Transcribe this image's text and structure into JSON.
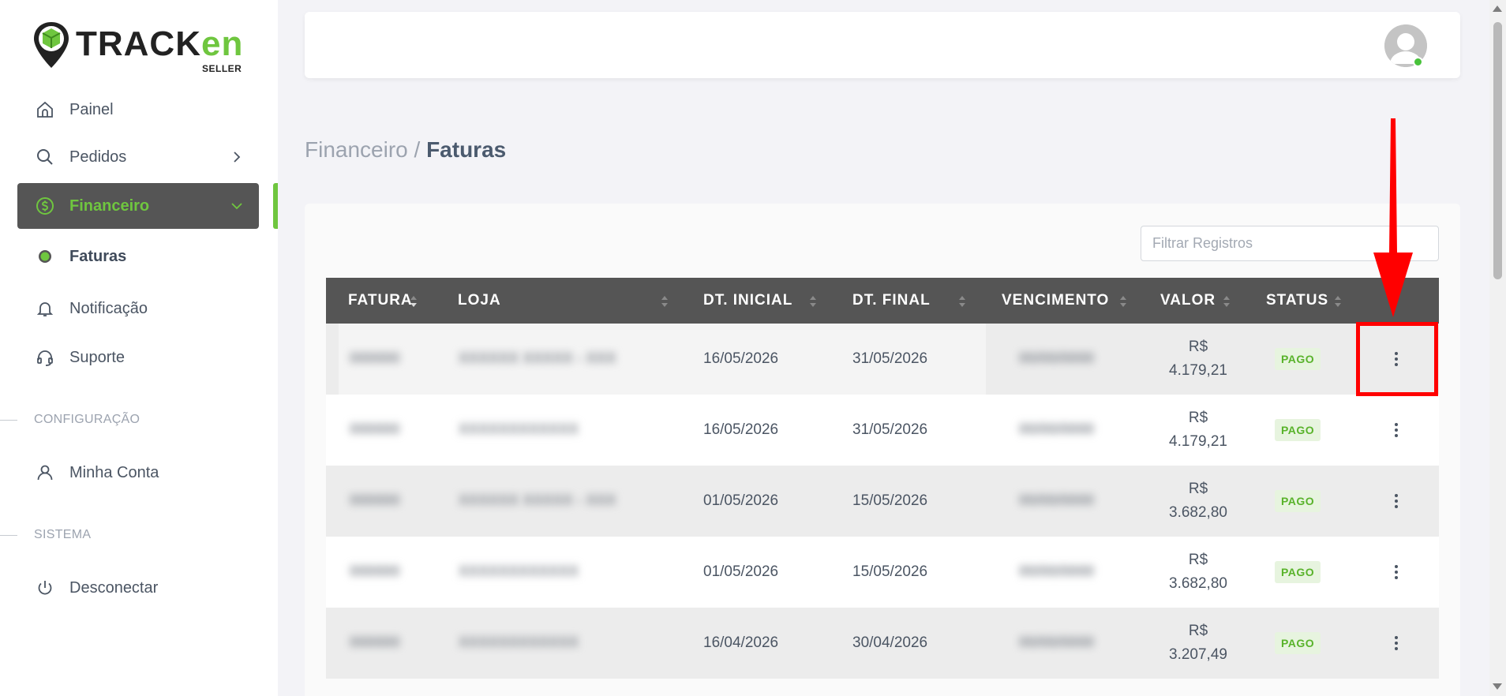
{
  "brand": {
    "name_main": "TRACK",
    "name_accent": "en",
    "sub": "SELLER",
    "accent_color": "#6fc63f"
  },
  "sidebar": {
    "items": [
      {
        "label": "Painel",
        "icon": "home-icon"
      },
      {
        "label": "Pedidos",
        "icon": "search-icon",
        "has_chevron": true
      },
      {
        "label": "Financeiro",
        "icon": "dollar-circle-icon",
        "active": true,
        "expanded": true
      },
      {
        "label": "Faturas",
        "icon": "dot-icon",
        "sub": true
      },
      {
        "label": "Notificação",
        "icon": "bell-icon"
      },
      {
        "label": "Suporte",
        "icon": "headset-icon"
      },
      {
        "label": "Minha Conta",
        "icon": "user-icon"
      },
      {
        "label": "Desconectar",
        "icon": "power-icon"
      }
    ],
    "sections": [
      "CONFIGURAÇÃO",
      "SISTEMA"
    ]
  },
  "breadcrumb": {
    "parent": "Financeiro",
    "separator": "/",
    "current": "Faturas"
  },
  "filter": {
    "placeholder": "Filtrar Registros",
    "value": ""
  },
  "table": {
    "columns": [
      "FATURA",
      "LOJA",
      "DT. INICIAL",
      "DT. FINAL",
      "VENCIMENTO",
      "VALOR",
      "STATUS"
    ],
    "rows": [
      {
        "fatura": "000000",
        "loja": "XXXXXX XXXXX - XXX",
        "dt_inicial": "16/05/2026",
        "dt_final": "31/05/2026",
        "vencimento": "00/00/0000",
        "valor_currency": "R$",
        "valor_amount": "4.179,21",
        "status": "PAGO"
      },
      {
        "fatura": "000000",
        "loja": "XXXXXXXXXXXX",
        "dt_inicial": "16/05/2026",
        "dt_final": "31/05/2026",
        "vencimento": "00/00/0000",
        "valor_currency": "R$",
        "valor_amount": "4.179,21",
        "status": "PAGO"
      },
      {
        "fatura": "000000",
        "loja": "XXXXXX XXXXX - XXX",
        "dt_inicial": "01/05/2026",
        "dt_final": "15/05/2026",
        "vencimento": "00/00/0000",
        "valor_currency": "R$",
        "valor_amount": "3.682,80",
        "status": "PAGO"
      },
      {
        "fatura": "000000",
        "loja": "XXXXXXXXXXXX",
        "dt_inicial": "01/05/2026",
        "dt_final": "15/05/2026",
        "vencimento": "00/00/0000",
        "valor_currency": "R$",
        "valor_amount": "3.682,80",
        "status": "PAGO"
      },
      {
        "fatura": "000000",
        "loja": "XXXXXXXXXXXX",
        "dt_inicial": "16/04/2026",
        "dt_final": "30/04/2026",
        "vencimento": "00/00/0000",
        "valor_currency": "R$",
        "valor_amount": "3.207,49",
        "status": "PAGO"
      }
    ]
  },
  "colors": {
    "header_bg": "#555555",
    "status_green": "#59b32b",
    "annotation_red": "#ff0000"
  }
}
